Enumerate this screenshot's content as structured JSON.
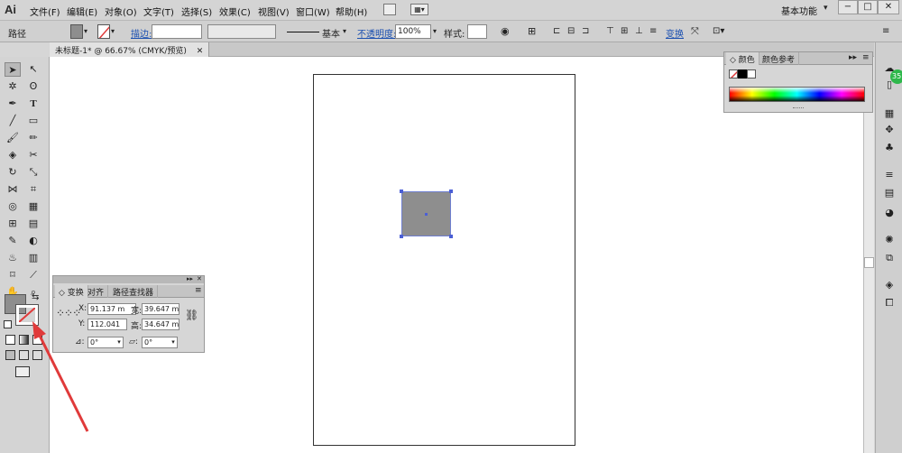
{
  "app": {
    "logo": "Ai"
  },
  "menu": {
    "items": [
      "文件(F)",
      "编辑(E)",
      "对象(O)",
      "文字(T)",
      "选择(S)",
      "效果(C)",
      "视图(V)",
      "窗口(W)",
      "帮助(H)"
    ],
    "workspace": "基本功能",
    "window_buttons": [
      "−",
      "□",
      "✕"
    ]
  },
  "control_bar": {
    "selection_label": "路径",
    "stroke_link": "描边:",
    "brush_value": "基本",
    "opacity_link": "不透明度:",
    "opacity_value": "100%",
    "style_label": "样式:",
    "transform_link": "变换"
  },
  "document": {
    "tab_title": "未标题-1* @ 66.67% (CMYK/预览)"
  },
  "colors": {
    "fill": "#8e8e8e",
    "selection": "#4b5fd6",
    "annotation_arrow": "#e03a3a"
  },
  "color_panel": {
    "tabs": [
      "颜色",
      "颜色参考"
    ]
  },
  "transform_panel": {
    "tabs": [
      "变换",
      "对齐",
      "路径查找器"
    ],
    "x_label": "X:",
    "x_value": "91.137 m",
    "y_label": "Y:",
    "y_value": "112.041",
    "w_label": "宽:",
    "w_value": "39.647 m",
    "h_label": "高:",
    "h_value": "34.647 m",
    "rotate_value": "0°",
    "shear_value": "0°"
  },
  "badge": {
    "text": "35"
  }
}
